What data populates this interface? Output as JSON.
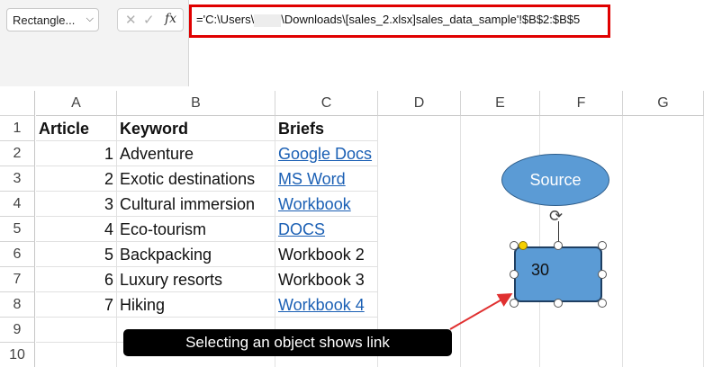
{
  "formula_bar": {
    "name_box": "Rectangle...",
    "fx_label": "fx",
    "formula_prefix": "='C:\\Users\\",
    "formula_suffix": "\\Downloads\\[sales_2.xlsx]sales_data_sample'!$B$2:$B$5"
  },
  "columns": [
    "A",
    "B",
    "C",
    "D",
    "E",
    "F",
    "G"
  ],
  "rows": [
    "1",
    "2",
    "3",
    "4",
    "5",
    "6",
    "7",
    "8",
    "9",
    "10"
  ],
  "table": {
    "headers": [
      "Article",
      "Keyword",
      "Briefs"
    ],
    "rows": [
      {
        "article": "1",
        "keyword": "Adventure",
        "brief": "Google Docs"
      },
      {
        "article": "2",
        "keyword": "Exotic destinations",
        "brief": "MS Word"
      },
      {
        "article": "3",
        "keyword": "Cultural immersion",
        "brief": "Workbook"
      },
      {
        "article": "4",
        "keyword": "Eco-tourism",
        "brief": "DOCS"
      },
      {
        "article": "5",
        "keyword": "Backpacking",
        "brief": "Workbook 2"
      },
      {
        "article": "6",
        "keyword": "Luxury resorts",
        "brief": "Workbook 3"
      },
      {
        "article": "7",
        "keyword": "Hiking",
        "brief": "Workbook 4"
      }
    ]
  },
  "shapes": {
    "ellipse_label": "Source",
    "rectangle_value": "30"
  },
  "tooltip": "Selecting an object shows link",
  "colors": {
    "shape_fill": "#5b9bd5",
    "highlight": "#e00000",
    "link": "#1a5fb4",
    "arrow": "#e03030"
  }
}
